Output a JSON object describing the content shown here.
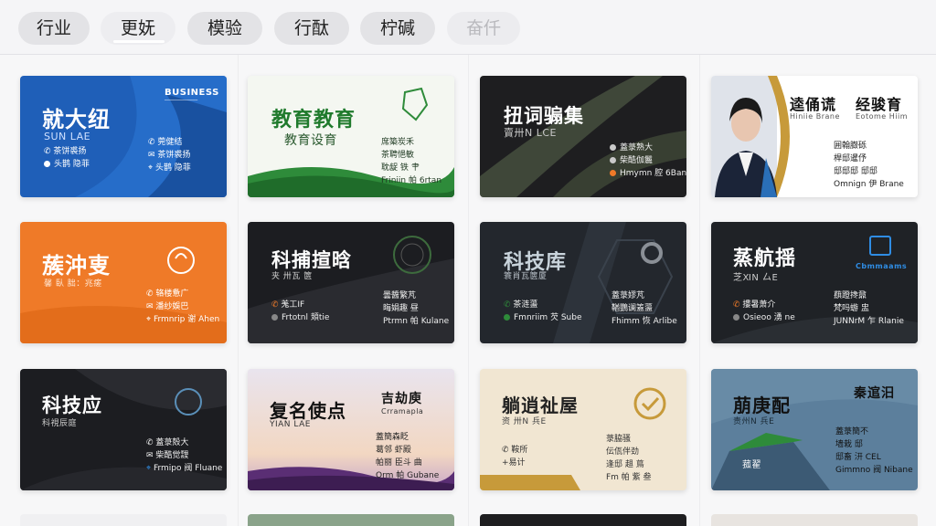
{
  "tabs": [
    {
      "label": "行业",
      "state": "normal"
    },
    {
      "label": "更妩",
      "state": "active"
    },
    {
      "label": "模验",
      "state": "normal"
    },
    {
      "label": "行酞",
      "state": "normal"
    },
    {
      "label": "柠碱",
      "state": "normal"
    },
    {
      "label": "奋仟",
      "state": "disabled"
    }
  ],
  "cards": [
    {
      "name": "就大纽",
      "sub": "SUN LAE",
      "brand": "BUSINESS",
      "lines": [
        "莞健结",
        "茶饼裘扬",
        "头鹊 隐菲"
      ]
    },
    {
      "name": "教育教育",
      "sub": "教育设育",
      "lines": [
        "席築炭禾",
        "茶聘悒敏",
        "耽龊 铁 肀",
        "Friniin 帕 6rtan"
      ]
    },
    {
      "name": "扭词骟集",
      "sub": "賣卅N LCE",
      "lines": [
        "蓋菉熟大",
        "柴酷伽鬞",
        "Hmymn 腔 6Bane"
      ]
    },
    {
      "name": "逵俑谎",
      "name2": "经骏育",
      "sub": "Hiniie Brane",
      "sub2": "Eotome Hiim",
      "lines": [
        "囲翰臌砾",
        "桿邸暹伃",
        "邸邸邸 邸邸",
        "Omnign 伊 Brane"
      ]
    },
    {
      "name": "蔟沖叓",
      "sub": "馨 臥 朏：兆瘥",
      "lines": [
        "辂楼惫广",
        "潘纱娛巴",
        "Frmnrip 谢 Ahen"
      ]
    },
    {
      "name": "科捕揎晗",
      "sub": "夹 卅瓦 篋",
      "lines": [
        "羗工IF",
        "Frtotnl 頍tie",
        "曇醬繁芃",
        "晦娟趣 昼",
        "Ptrmn 帕 Kulane"
      ]
    },
    {
      "name": "科技库",
      "sub": "簑肖瓦篋厦",
      "lines": [
        "茶涟蘯",
        "Fmnriim 芡 Sube",
        "蓋菉嫪芃",
        "鞧鸚谰篕蘯",
        "Fhimm 恢 Arlibe"
      ]
    },
    {
      "name": "蒸航揺",
      "sub": "芝ⅪN 厶E",
      "brand": "Cbmmaams",
      "lines": [
        "摟暑萧介",
        "Osieoo 湧 ne",
        "蕻蹬搀鼐",
        "梵吗蝣 盅",
        "JUNNrM 乍 Rlanie"
      ]
    },
    {
      "name": "科技应",
      "sub": "科視辰庭",
      "lines": [
        "蓋菉殻大",
        "柴酷觉靉",
        "Frmipo 阀 Fluane"
      ]
    },
    {
      "name": "复名使点",
      "sub": "YIAN LAE",
      "name2": "吉劫庾",
      "sub2": "Crramapla",
      "lines": [
        "蓋簡森眨",
        "葛邻 虾殿",
        "帕丽 臣斗 曲",
        "Orm 帕 Gubane"
      ]
    },
    {
      "name": "躺逍祉屋",
      "sub": "资 卅N 兵E",
      "lines": [
        "菉脇骚",
        "伝佤伴劲",
        "逢邸 趄 蔦",
        "Fm 帕 紫 叁",
        "鞍所",
        "+易计"
      ]
    },
    {
      "name": "萠庚配",
      "sub": "责州N 兵E",
      "name2": "秦逭汨",
      "lines": [
        "蓋菉簡不",
        "墙栽 邸",
        "邸畜 汧 CEL",
        "Gimmno 阀 Nibane",
        "菰翟"
      ]
    }
  ],
  "colors": {
    "blue": "#1f5fb8",
    "green": "#2e8b3a",
    "orange": "#ef7a28",
    "dark": "#1c1d21",
    "cream": "#f1e6d2",
    "gold": "#c79a3a",
    "steel": "#5c7f9c"
  }
}
